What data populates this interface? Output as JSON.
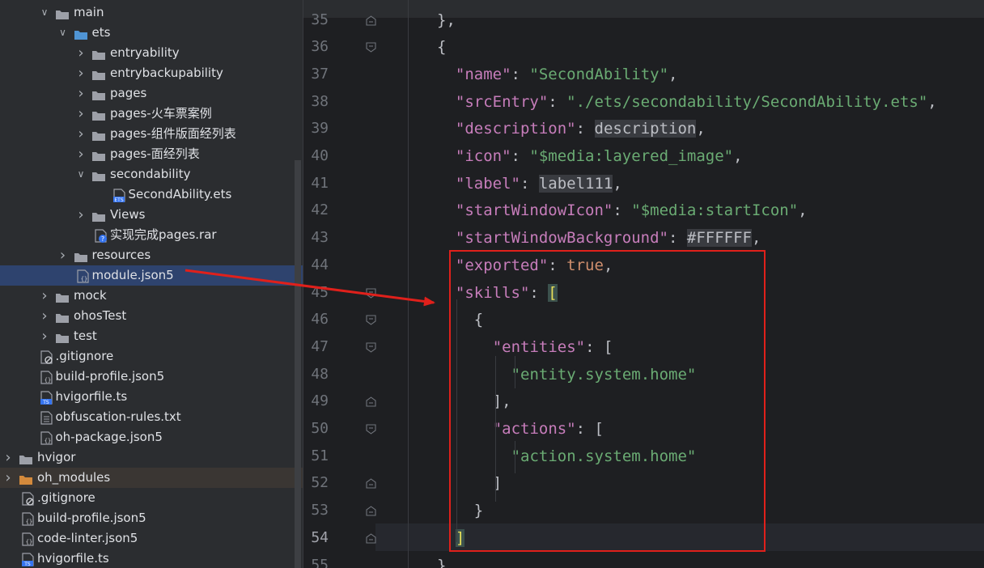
{
  "project_tree": {
    "items": [
      {
        "label": "main",
        "kind": "folder",
        "expanded": true,
        "depth": 3
      },
      {
        "label": "ets",
        "kind": "folder-src",
        "expanded": true,
        "depth": 4
      },
      {
        "label": "entryability",
        "kind": "folder",
        "expanded": false,
        "depth": 5
      },
      {
        "label": "entrybackupability",
        "kind": "folder",
        "expanded": false,
        "depth": 5
      },
      {
        "label": "pages",
        "kind": "folder",
        "expanded": false,
        "depth": 5
      },
      {
        "label": "pages-火车票案例",
        "kind": "folder",
        "expanded": false,
        "depth": 5
      },
      {
        "label": "pages-组件版面经列表",
        "kind": "folder",
        "expanded": false,
        "depth": 5
      },
      {
        "label": "pages-面经列表",
        "kind": "folder",
        "expanded": false,
        "depth": 5
      },
      {
        "label": "secondability",
        "kind": "folder",
        "expanded": true,
        "depth": 5
      },
      {
        "label": "SecondAbility.ets",
        "kind": "file-ets",
        "depth": 6
      },
      {
        "label": "Views",
        "kind": "folder",
        "expanded": false,
        "depth": 5
      },
      {
        "label": "实现完成pages.rar",
        "kind": "file-unknown",
        "depth": 5
      },
      {
        "label": "resources",
        "kind": "folder",
        "expanded": false,
        "depth": 4
      },
      {
        "label": "module.json5",
        "kind": "file-json",
        "depth": 4,
        "selected": true
      },
      {
        "label": "mock",
        "kind": "folder",
        "expanded": false,
        "depth": 3
      },
      {
        "label": "ohosTest",
        "kind": "folder",
        "expanded": false,
        "depth": 3
      },
      {
        "label": "test",
        "kind": "folder",
        "expanded": false,
        "depth": 3
      },
      {
        "label": ".gitignore",
        "kind": "file-ignore",
        "depth": 2
      },
      {
        "label": "build-profile.json5",
        "kind": "file-json",
        "depth": 2
      },
      {
        "label": "hvigorfile.ts",
        "kind": "file-ts",
        "depth": 2
      },
      {
        "label": "obfuscation-rules.txt",
        "kind": "file-text",
        "depth": 2
      },
      {
        "label": "oh-package.json5",
        "kind": "file-json",
        "depth": 2
      },
      {
        "label": "hvigor",
        "kind": "folder",
        "expanded": false,
        "depth": 1
      },
      {
        "label": "oh_modules",
        "kind": "folder-excluded",
        "expanded": false,
        "depth": 1,
        "excluded": true
      },
      {
        "label": ".gitignore",
        "kind": "file-ignore",
        "depth": 1
      },
      {
        "label": "build-profile.json5",
        "kind": "file-json",
        "depth": 1
      },
      {
        "label": "code-linter.json5",
        "kind": "file-json",
        "depth": 1
      },
      {
        "label": "hvigorfile.ts",
        "kind": "file-ts",
        "depth": 1
      }
    ]
  },
  "editor": {
    "current_line": "54",
    "lines": [
      {
        "num": "35",
        "tokens": [
          {
            "t": "},",
            "c": "p"
          }
        ],
        "indent": 6
      },
      {
        "num": "36",
        "tokens": [
          {
            "t": "{",
            "c": "p"
          }
        ],
        "indent": 6
      },
      {
        "num": "37",
        "tokens": [
          {
            "t": "\"name\"",
            "c": "k"
          },
          {
            "t": ": ",
            "c": "p"
          },
          {
            "t": "\"SecondAbility\"",
            "c": "s"
          },
          {
            "t": ",",
            "c": "p"
          }
        ],
        "indent": 8
      },
      {
        "num": "38",
        "tokens": [
          {
            "t": "\"srcEntry\"",
            "c": "k"
          },
          {
            "t": ": ",
            "c": "p"
          },
          {
            "t": "\"./ets/secondability/SecondAbility.ets\"",
            "c": "s"
          },
          {
            "t": ",",
            "c": "p"
          }
        ],
        "indent": 8
      },
      {
        "num": "39",
        "tokens": [
          {
            "t": "\"description\"",
            "c": "k"
          },
          {
            "t": ": ",
            "c": "p"
          },
          {
            "t": "description",
            "c": "bare"
          },
          {
            "t": ",",
            "c": "p"
          }
        ],
        "indent": 8
      },
      {
        "num": "40",
        "tokens": [
          {
            "t": "\"icon\"",
            "c": "k"
          },
          {
            "t": ": ",
            "c": "p"
          },
          {
            "t": "\"$media:layered_image\"",
            "c": "s"
          },
          {
            "t": ",",
            "c": "p"
          }
        ],
        "indent": 8
      },
      {
        "num": "41",
        "tokens": [
          {
            "t": "\"label\"",
            "c": "k"
          },
          {
            "t": ": ",
            "c": "p"
          },
          {
            "t": "label111",
            "c": "bare"
          },
          {
            "t": ",",
            "c": "p"
          }
        ],
        "indent": 8
      },
      {
        "num": "42",
        "tokens": [
          {
            "t": "\"startWindowIcon\"",
            "c": "k"
          },
          {
            "t": ": ",
            "c": "p"
          },
          {
            "t": "\"$media:startIcon\"",
            "c": "s"
          },
          {
            "t": ",",
            "c": "p"
          }
        ],
        "indent": 8
      },
      {
        "num": "43",
        "tokens": [
          {
            "t": "\"startWindowBackground\"",
            "c": "k"
          },
          {
            "t": ": ",
            "c": "p"
          },
          {
            "t": "#FFFFFF",
            "c": "bare"
          },
          {
            "t": ",",
            "c": "p"
          }
        ],
        "indent": 8
      },
      {
        "num": "44",
        "tokens": [
          {
            "t": "\"exported\"",
            "c": "k"
          },
          {
            "t": ": ",
            "c": "p"
          },
          {
            "t": "true",
            "c": "kw"
          },
          {
            "t": ",",
            "c": "p"
          }
        ],
        "indent": 8
      },
      {
        "num": "45",
        "tokens": [
          {
            "t": "\"skills\"",
            "c": "k"
          },
          {
            "t": ": ",
            "c": "p"
          },
          {
            "t": "[",
            "c": "brk-hl"
          }
        ],
        "indent": 8
      },
      {
        "num": "46",
        "tokens": [
          {
            "t": "{",
            "c": "p"
          }
        ],
        "indent": 10
      },
      {
        "num": "47",
        "tokens": [
          {
            "t": "\"entities\"",
            "c": "k"
          },
          {
            "t": ": ",
            "c": "p"
          },
          {
            "t": "[",
            "c": "p"
          }
        ],
        "indent": 12
      },
      {
        "num": "48",
        "tokens": [
          {
            "t": "\"entity.system.home\"",
            "c": "s"
          }
        ],
        "indent": 14
      },
      {
        "num": "49",
        "tokens": [
          {
            "t": "],",
            "c": "p"
          }
        ],
        "indent": 12
      },
      {
        "num": "50",
        "tokens": [
          {
            "t": "\"actions\"",
            "c": "k"
          },
          {
            "t": ": ",
            "c": "p"
          },
          {
            "t": "[",
            "c": "p"
          }
        ],
        "indent": 12
      },
      {
        "num": "51",
        "tokens": [
          {
            "t": "\"action.system.home\"",
            "c": "s"
          }
        ],
        "indent": 14
      },
      {
        "num": "52",
        "tokens": [
          {
            "t": "]",
            "c": "p"
          }
        ],
        "indent": 12
      },
      {
        "num": "53",
        "tokens": [
          {
            "t": "}",
            "c": "p"
          }
        ],
        "indent": 10
      },
      {
        "num": "54",
        "tokens": [
          {
            "t": "]",
            "c": "brk-hl"
          }
        ],
        "indent": 8
      },
      {
        "num": "55",
        "tokens": [
          {
            "t": "}",
            "c": "p"
          }
        ],
        "indent": 6
      }
    ]
  },
  "annotation": {
    "highlight_color": "#e0201b"
  }
}
